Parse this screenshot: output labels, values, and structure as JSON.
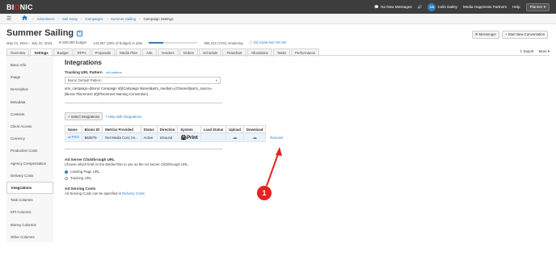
{
  "topbar": {
    "logo_prefix": "BI",
    "logo_o": "O",
    "logo_suffix": "NIC",
    "messages": "No New Messages",
    "user_initials": "CD",
    "user_name": "Colin Dailey",
    "company": "Media Happiness Partners",
    "help": "Help",
    "planner": "Planner"
  },
  "breadcrumbs": [
    "Advertisers",
    "Sail Away",
    "Campaigns",
    "Summer Sailing",
    "Campaign Settings"
  ],
  "campaign": {
    "title": "Summer Sailing",
    "dates": "May 01, 2024 – July 31, 2024",
    "budget": "500,000 budget",
    "in_plan": "143,667 (29% of budget) in plan",
    "remaining": "356,313 (71%) remaining",
    "in_plan_fraction": 0.29,
    "goal": "(0) Goals Not Yet Set"
  },
  "header_actions": {
    "messenger": "Messenger",
    "start_conversation": "+ Start New Conversation"
  },
  "tabs": [
    "Overview",
    "Settings",
    "Budget",
    "RFPs",
    "Proposals",
    "Media Plan",
    "Ads",
    "Vendors",
    "Orders",
    "Schedule",
    "Flowchart",
    "Allocations",
    "Tasks",
    "Performance"
  ],
  "active_tab": "Settings",
  "tab_actions": {
    "export": "Export",
    "more": "More"
  },
  "sidebar": [
    "Basic Info",
    "Image",
    "Description",
    "Metadata",
    "Contacts",
    "Client Access",
    "Currency",
    "Production Costs",
    "Agency Compensation",
    "Delivery Costs",
    "Integrations",
    "Task Columns",
    "KPI Columns",
    "Money Columns",
    "Other Columns"
  ],
  "active_sidebar": "Integrations",
  "integrations": {
    "heading": "Integrations",
    "tracking_label": "Tracking URL Pattern",
    "tracking_edit": "edit patterns",
    "select_value": "Bionic Default Pattern",
    "url_text": "utm_campaign={Bionic Campaign Id}{Campaign Name}&utm_medium={Channel}&utm_source={Bionic Placement Id}{Placement Naming Convention}",
    "select_button": "+ Select Integrations",
    "help_link": "Help with Integrations",
    "columns": [
      "Name",
      "Bionic ID",
      "Metrics Provided",
      "Status",
      "Direction",
      "System",
      "Load Status",
      "Upload",
      "Download"
    ],
    "rows": [
      {
        "name": "Print",
        "bionic_id": "B63979",
        "metrics": "Net Media Cost, Im...",
        "status": "Active",
        "direction": "Inbound",
        "system": "Print",
        "load_status": "",
        "remove": "Remove"
      }
    ],
    "ad_server_heading": "Ad Server Clickthrough URL",
    "ad_server_desc": "Choose which field on the Media Plan to use as the Ad Server Clickthrough URL",
    "radio_landing": "Landing Page URL",
    "radio_tracking": "Tracking URL",
    "ad_serving_heading": "Ad Serving Costs",
    "ad_serving_text": "Ad Serving Costs can be specified in",
    "delivery_link": "Delivery Costs"
  },
  "annotation": {
    "number": "1"
  }
}
